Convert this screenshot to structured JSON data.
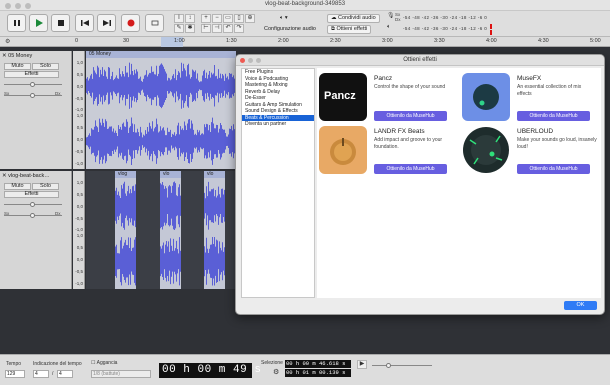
{
  "window": {
    "title": "vlog-beat-background-349853"
  },
  "toolbar": {
    "audio_setup": "Configurazione audio",
    "share_audio": "Condividi audio",
    "get_effects": "Ottieni effetti",
    "meter_scale_top": "-54 -48 -42 -36 -30 -24 -18 -12  -6  0",
    "meter_scale_bottom": "-54 -48 -42 -36 -30 -24 -18 -12  -6  0"
  },
  "ruler": {
    "ticks": [
      "0",
      "30",
      "1:00",
      "1:30",
      "2:00",
      "2:30",
      "3:00",
      "3:30",
      "4:00",
      "4:30",
      "5:00"
    ]
  },
  "track1": {
    "name": "05 Money",
    "clip": "05 Money",
    "mute": "Muto",
    "solo": "Solo",
    "effects": "Effetti",
    "pan_left": "Sx",
    "pan_right": "Dx",
    "scale": [
      "1,0",
      "0,5",
      "0,0",
      "-0,5",
      "-1,0",
      "1,0",
      "0,5",
      "0,0",
      "-0,5",
      "-1,0"
    ]
  },
  "track2": {
    "name": "vlog-beat-back…",
    "clips": [
      "vlog",
      "vlo",
      "vlo"
    ],
    "mute": "Muto",
    "solo": "Solo",
    "effects": "Effetti",
    "pan_left": "Sx",
    "pan_right": "Dx",
    "scale": [
      "1,0",
      "0,5",
      "0,0",
      "-0,5",
      "-1,0",
      "1,0",
      "0,5",
      "0,0",
      "-0,5",
      "-1,0"
    ]
  },
  "dialog": {
    "title": "Ottieni effetti",
    "categories": [
      "Free Plugins",
      "Voice & Podcasting",
      "Mastering & Mixing",
      "Reverb & Delay",
      "De-Esser",
      "Guitars & Amp Simulation",
      "Sound Design & Effects",
      "Beats & Percussion",
      "Diventa un partner"
    ],
    "active_category": "Beats & Percussion",
    "cards": [
      {
        "name": "Pancz",
        "desc": "Control the shape of your sound",
        "button": "Ottienilo da MuseHub",
        "logo_text": "Pancz"
      },
      {
        "name": "MuseFX",
        "desc": "An essential collection of mix effects",
        "button": "Ottienilo da MuseHub"
      },
      {
        "name": "LANDR FX Beats",
        "desc": "Add impact and groove to your foundation.",
        "button": "Ottienilo da MuseHub"
      },
      {
        "name": "UBERLOUD",
        "desc": "Make your sounds go loud, insanely loud!",
        "button": "Ottienilo da MuseHub"
      }
    ],
    "ok": "OK"
  },
  "bottom": {
    "tempo_label": "Tempo",
    "tempo_value": "129",
    "time_sig_label": "Indicazione del tempo",
    "time_sig_num": "4",
    "time_sig_den": "4",
    "snap_label": "Aggancia",
    "snap_value": "1/8 (battute)",
    "time_display": "00 h 00 m 49 s",
    "selection_label": "Selezione",
    "sel_start": "00 h 00 m 46.618 s",
    "sel_end": "00 h 01 m 00.139 s"
  },
  "colors": {
    "waveform": "#5a5fd6",
    "clip_header": "#a8b3d6",
    "musehub_button": "#675ee0",
    "ok_button": "#2f7bf5",
    "selected_category": "#1863d6"
  }
}
